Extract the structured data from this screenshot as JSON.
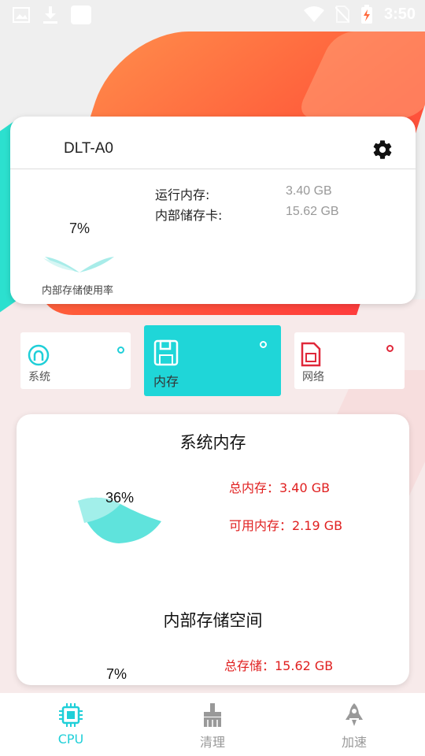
{
  "status_bar": {
    "time": "3:50",
    "left_icons": [
      "image-icon",
      "download-icon",
      "square-icon"
    ],
    "right_icons": [
      "wifi-icon",
      "no-sim-icon",
      "battery-charging-icon"
    ]
  },
  "device_card": {
    "device_name": "DLT-A0",
    "storage_percent_text": "7%",
    "storage_label": "内部存储使用率",
    "rows": [
      {
        "label": "运行内存:",
        "value": "3.40 GB"
      },
      {
        "label": "内部储存卡:",
        "value": "15.62 GB"
      }
    ]
  },
  "tabs": [
    {
      "label": "系统",
      "icon": "system-icon",
      "selected": false
    },
    {
      "label": "内存",
      "icon": "floppy-disk-icon",
      "selected": true
    },
    {
      "label": "网络",
      "icon": "sim-card-icon",
      "selected": false
    }
  ],
  "memory_card": {
    "title": "系统内存",
    "percent_text": "36%",
    "total_label": "总内存：3.40 GB",
    "available_label": "可用内存：2.19 GB",
    "storage_title": "内部存储空间",
    "storage_total_label": "总存储：15.62 GB",
    "storage_percent_text": "7%"
  },
  "bottom_nav": [
    {
      "label": "CPU",
      "icon": "cpu-chip-icon",
      "active": true
    },
    {
      "label": "清理",
      "icon": "broom-icon",
      "active": false
    },
    {
      "label": "加速",
      "icon": "rocket-icon",
      "active": false
    }
  ],
  "colors": {
    "accent_teal": "#1fcfd8",
    "red": "#e02020",
    "orange_bg": "#ff6a3d",
    "teal_bg": "#2ce0cf"
  }
}
